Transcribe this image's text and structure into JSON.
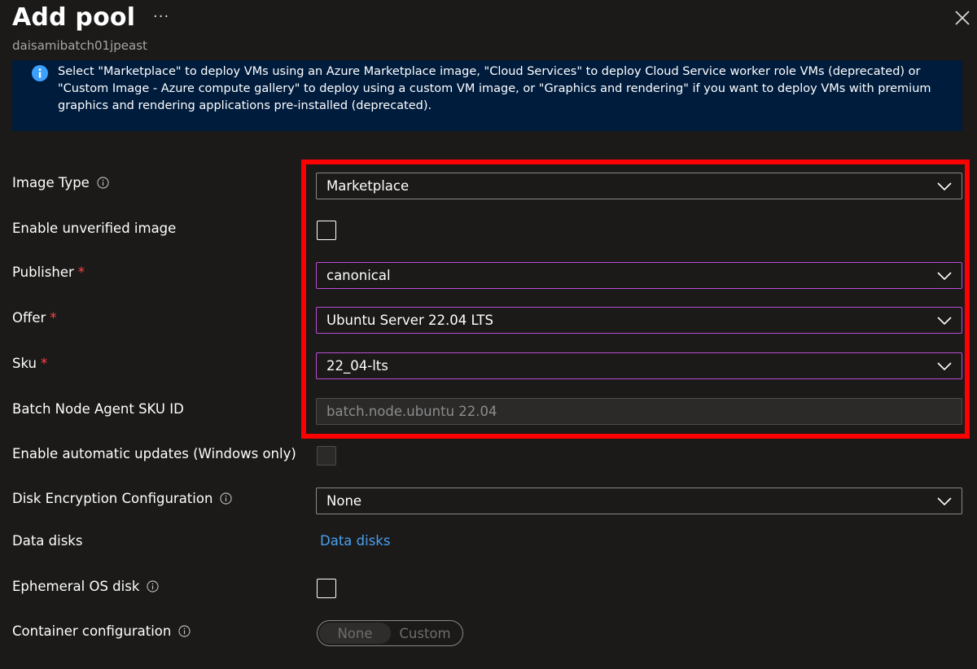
{
  "header": {
    "title": "Add pool",
    "more": "···",
    "subtitle": "daisamibatch01jpeast"
  },
  "banner": {
    "text": "Select \"Marketplace\" to deploy VMs using an Azure Marketplace image, \"Cloud Services\" to deploy Cloud Service worker role VMs (deprecated) or \"Custom Image - Azure compute gallery\" to deploy using a custom VM image, or \"Graphics and rendering\" if you want to deploy VMs with premium graphics and rendering applications pre-installed (deprecated)."
  },
  "form": {
    "image_type": {
      "label": "Image Type",
      "value": "Marketplace"
    },
    "unverified": {
      "label": "Enable unverified image",
      "checked": false
    },
    "publisher": {
      "label": "Publisher",
      "value": "canonical",
      "required": "*"
    },
    "offer": {
      "label": "Offer",
      "value": "Ubuntu Server 22.04 LTS",
      "required": "*"
    },
    "sku": {
      "label": "Sku",
      "value": "22_04-lts",
      "required": "*"
    },
    "agent_sku": {
      "label": "Batch Node Agent SKU ID",
      "value": "batch.node.ubuntu 22.04"
    },
    "auto_updates": {
      "label": "Enable automatic updates (Windows only)",
      "checked": false
    },
    "disk_encryption": {
      "label": "Disk Encryption Configuration",
      "value": "None"
    },
    "data_disks": {
      "label": "Data disks",
      "link": "Data disks"
    },
    "ephemeral": {
      "label": "Ephemeral OS disk",
      "checked": false
    },
    "container": {
      "label": "Container configuration",
      "options": [
        "None",
        "Custom"
      ],
      "selected": "None"
    }
  },
  "colors": {
    "background": "#1b1a19",
    "banner": "#001c3d",
    "accent_link": "#4aa0f0",
    "focus_border": "#b84dd6",
    "highlight": "#ff0000",
    "required": "#ff4343"
  }
}
